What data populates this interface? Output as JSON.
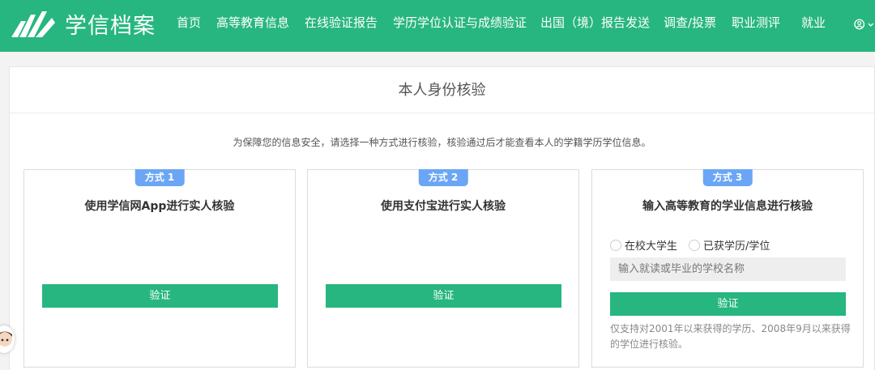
{
  "header": {
    "logo_text": "学信档案",
    "nav": [
      "首页",
      "高等教育信息",
      "在线验证报告",
      "学历学位认证与成绩验证",
      "出国（境）报告发送",
      "调查/投票",
      "职业测评",
      "就业"
    ],
    "user_icon": "user-circle-icon"
  },
  "panel": {
    "title": "本人身份核验",
    "notice": "为保障您的信息安全，请选择一种方式进行核验，核验通过后才能查看本人的学籍学历学位信息。"
  },
  "cards": [
    {
      "badge": "方式 1",
      "title": "使用学信网App进行实人核验",
      "button": "验证"
    },
    {
      "badge": "方式 2",
      "title": "使用支付宝进行实人核验",
      "button": "验证"
    },
    {
      "badge": "方式 3",
      "title": "输入高等教育的学业信息进行核验",
      "radio_current": "在校大学生",
      "radio_graduated": "已获学历/学位",
      "input_placeholder": "输入就读或毕业的学校名称",
      "button": "验证",
      "footnote": "仅支持对2001年以来获得的学历、2008年9月以来获得的学位进行核验。"
    }
  ],
  "colors": {
    "brand": "#27b67f",
    "badge": "#6aa6f5"
  }
}
